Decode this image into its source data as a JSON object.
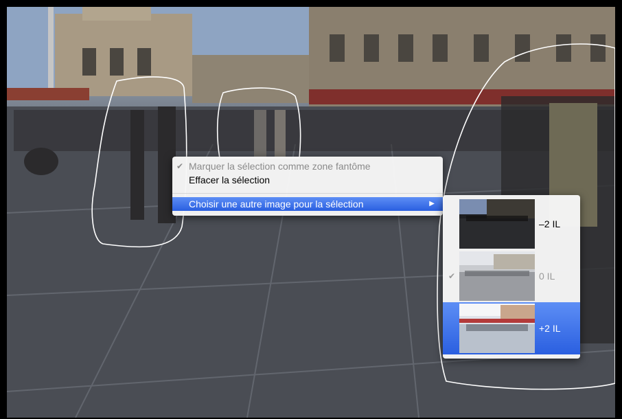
{
  "context_menu": {
    "items": [
      {
        "label": "Marquer la sélection comme zone fantôme",
        "checked": true,
        "enabled": false
      },
      {
        "label": "Effacer la sélection",
        "enabled": true
      },
      {
        "label": "Choisir une autre image pour la sélection",
        "highlighted": true,
        "has_submenu": true
      }
    ]
  },
  "submenu": {
    "items": [
      {
        "label": "–2 IL",
        "checked": false,
        "enabled": true
      },
      {
        "label": "0 IL",
        "checked": true,
        "enabled": false
      },
      {
        "label": "+2 IL",
        "checked": false,
        "highlighted": true
      }
    ]
  },
  "colors": {
    "highlight": "#3b6fe8",
    "selection_outline": "#ffffff"
  }
}
